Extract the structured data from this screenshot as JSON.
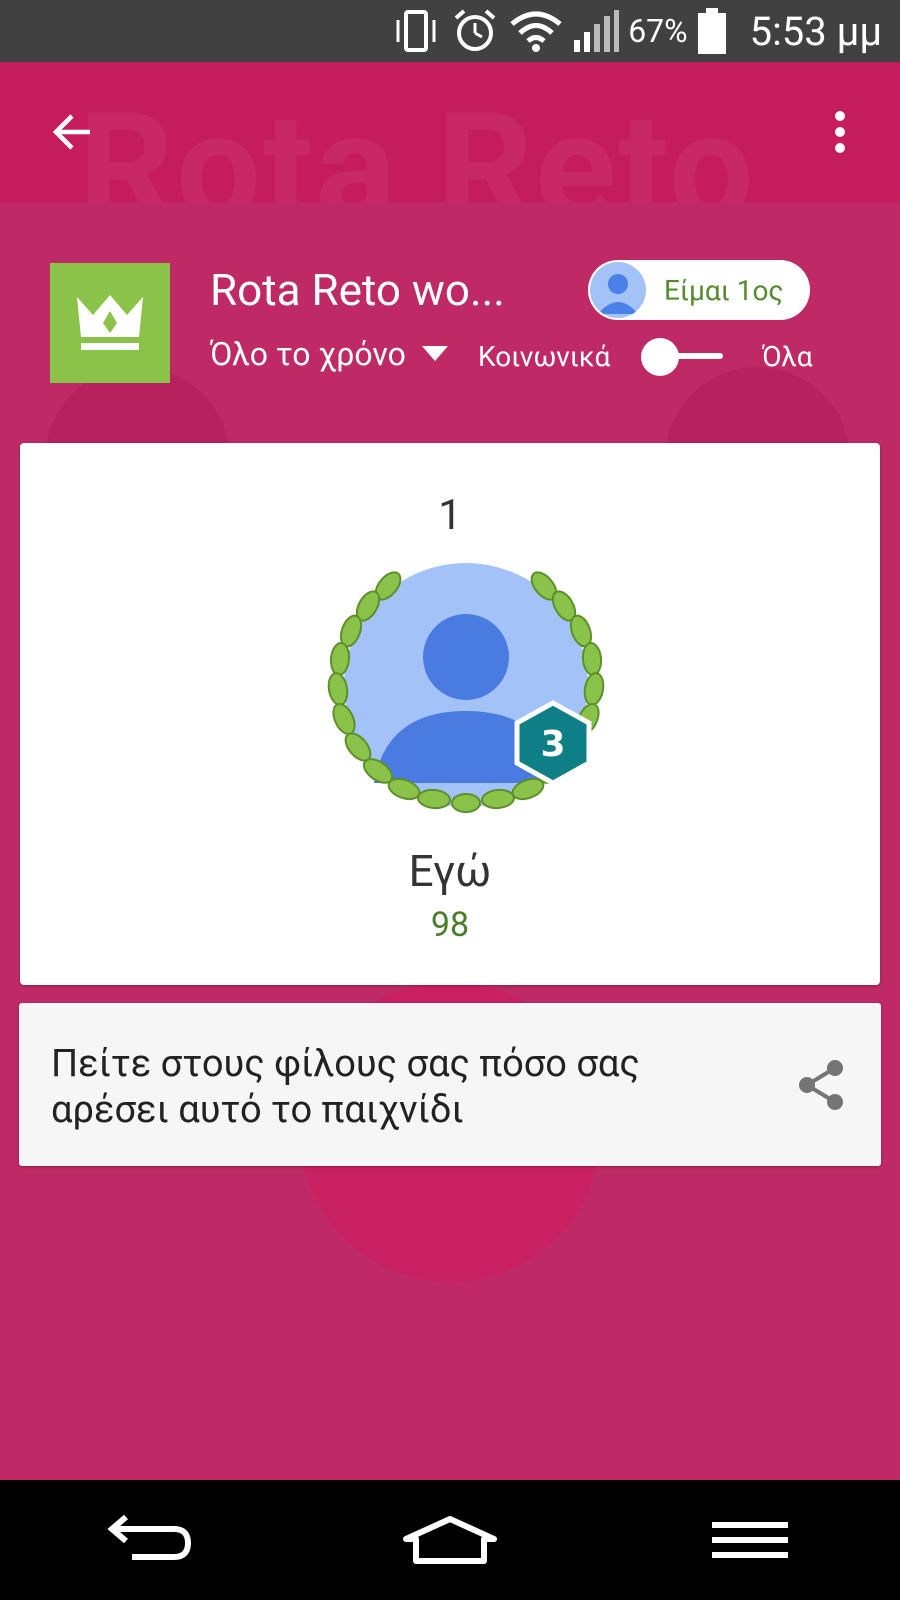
{
  "status_bar": {
    "battery_percent": "67%",
    "time": "5:53 μμ",
    "icons": [
      "vibrate-icon",
      "alarm-icon",
      "wifi-icon",
      "signal-icon",
      "battery-icon"
    ]
  },
  "app_bar": {
    "watermark": "Rota Reto",
    "back_icon": "arrow-back-icon",
    "more_icon": "more-vert-icon"
  },
  "header": {
    "game_icon": "crown-icon",
    "game_title": "Rota Reto wo...",
    "me_pill_label": "Είμαι 1ος",
    "time_filter": "Όλο το χρόνο",
    "social_label": "Κοινωνικά",
    "all_label": "Όλα",
    "toggle_on": false
  },
  "leader": {
    "rank": "1",
    "name": "Εγώ",
    "score": "98",
    "level_badge": "3"
  },
  "share": {
    "text": "Πείτε στους φίλους σας πόσο σας αρέσει αυτό το παιχνίδι",
    "icon": "share-icon"
  },
  "nav_bar": {
    "icons": [
      "back-nav-icon",
      "home-nav-icon",
      "menu-nav-icon"
    ]
  },
  "colors": {
    "primary": "#c51c5d",
    "background": "#bf2a66",
    "accent_green": "#8bc34a",
    "score_green": "#4a7f2a",
    "badge_teal": "#0e7f86"
  }
}
